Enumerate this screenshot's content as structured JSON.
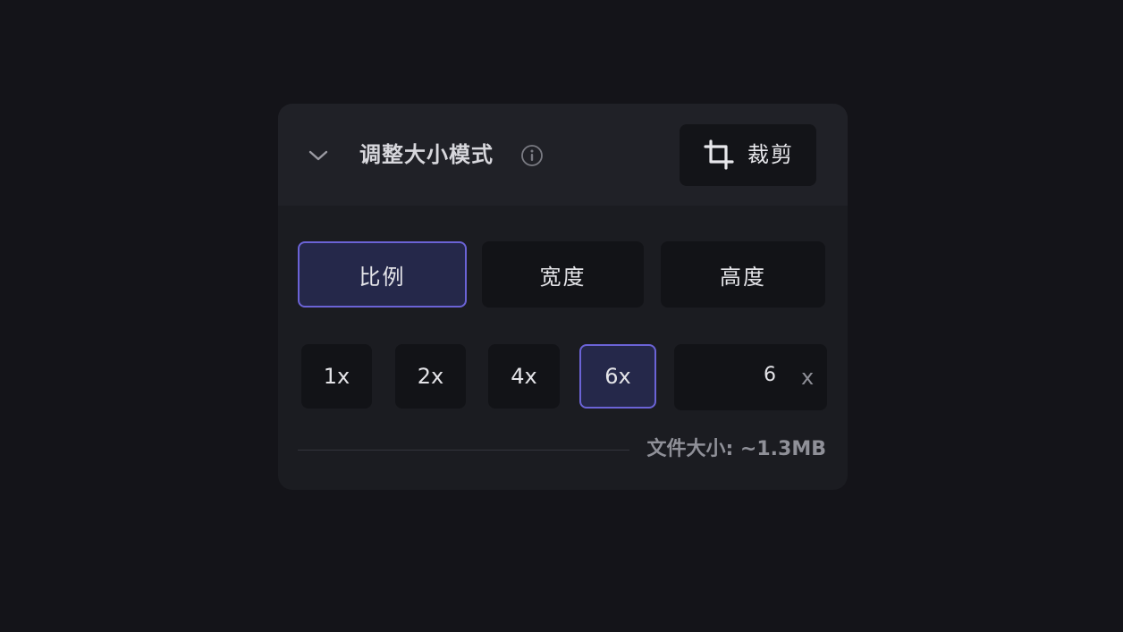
{
  "header": {
    "title": "调整大小模式",
    "chevron_icon": "chevron-down-icon",
    "info_icon": "info-icon",
    "crop_button": {
      "label": "裁剪",
      "icon": "crop-icon"
    }
  },
  "modes": [
    {
      "label": "比例",
      "active": true
    },
    {
      "label": "宽度",
      "active": false
    },
    {
      "label": "高度",
      "active": false
    }
  ],
  "scales": [
    {
      "label": "1x",
      "active": false
    },
    {
      "label": "2x",
      "active": false
    },
    {
      "label": "4x",
      "active": false
    },
    {
      "label": "6x",
      "active": true
    }
  ],
  "custom_scale": {
    "value": "6",
    "suffix": "x"
  },
  "footer": {
    "file_size": "文件大小: ~1.3MB"
  },
  "colors": {
    "background": "#141419",
    "panel": "#1b1c21",
    "active_border": "#6b63d6",
    "active_fill": "#25284a"
  }
}
